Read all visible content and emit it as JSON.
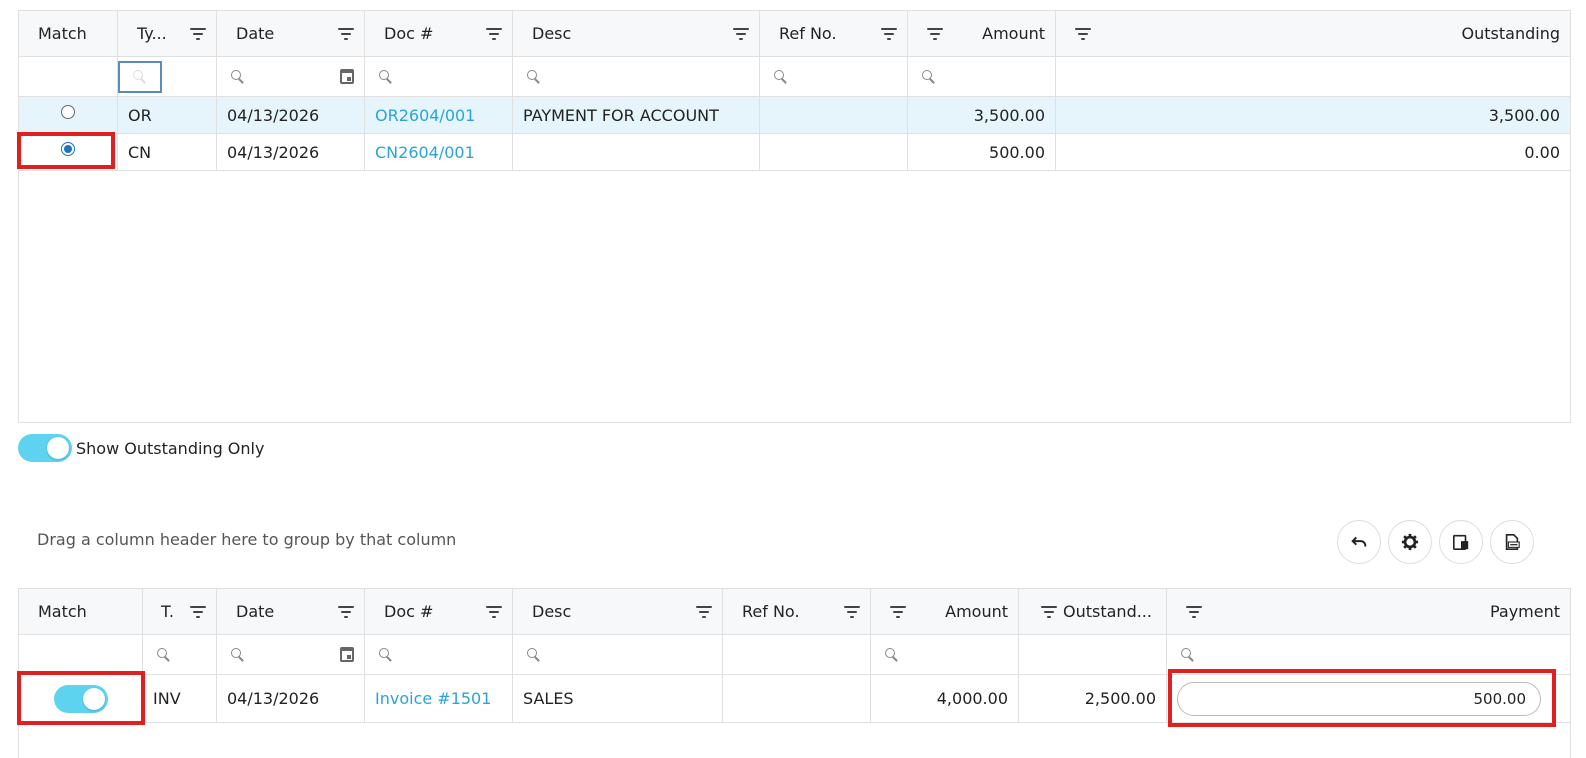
{
  "grid1": {
    "headers": [
      "Match",
      "Ty...",
      "Date",
      "Doc #",
      "Desc",
      "Ref No.",
      "Amount",
      "Outstanding"
    ],
    "rows": [
      {
        "type": "OR",
        "date": "04/13/2026",
        "doc": "OR2604/001",
        "desc": "PAYMENT FOR ACCOUNT",
        "ref": "",
        "amount": "3,500.00",
        "outstanding": "3,500.00",
        "selected": false
      },
      {
        "type": "CN",
        "date": "04/13/2026",
        "doc": "CN2604/001",
        "desc": "",
        "ref": "",
        "amount": "500.00",
        "outstanding": "0.00",
        "selected": true
      }
    ]
  },
  "toggle_outstanding": {
    "label": "Show Outstanding Only",
    "on": true
  },
  "group_panel": {
    "text": "Drag a column header here to group by that column"
  },
  "toolbar": {
    "icons": [
      "undo-icon",
      "gear-icon",
      "column-chooser-icon",
      "export-icon"
    ]
  },
  "grid2": {
    "headers": [
      "Match",
      "T.",
      "Date",
      "Doc #",
      "Desc",
      "Ref No.",
      "Amount",
      "Outstand...",
      "Payment"
    ],
    "rows": [
      {
        "match": true,
        "type": "INV",
        "date": "04/13/2026",
        "doc": "Invoice #1501",
        "desc": "SALES",
        "ref": "",
        "amount": "4,000.00",
        "outstanding": "2,500.00",
        "payment": "500.00"
      }
    ]
  },
  "colors": {
    "accent": "#2aa4d8",
    "toggle": "#5ed3ef",
    "highlight": "#e02020",
    "selected_row": "#e6f5fc"
  }
}
